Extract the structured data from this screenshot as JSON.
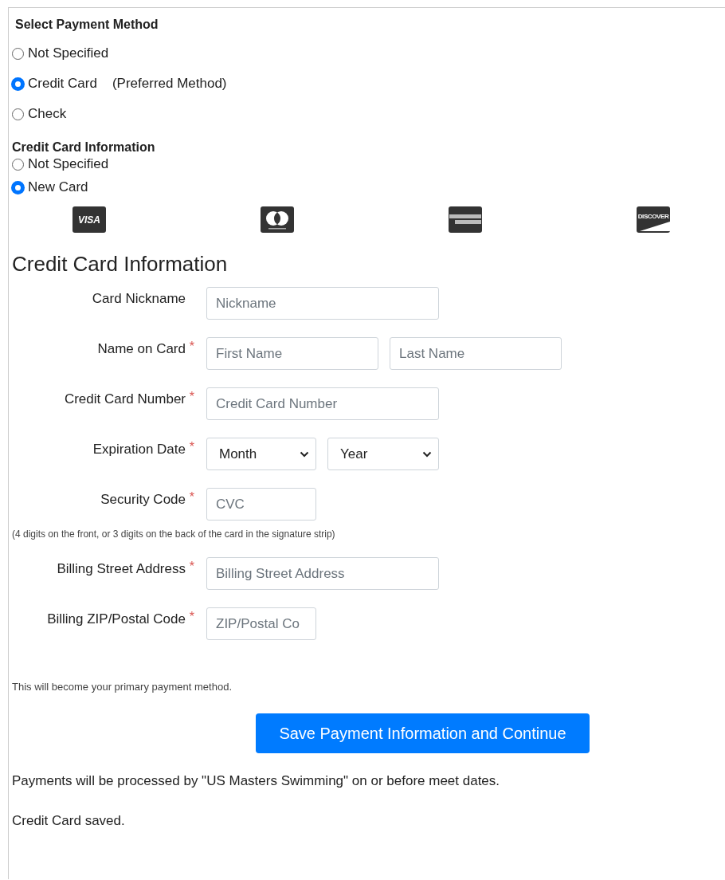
{
  "payment_method": {
    "title": "Select Payment Method",
    "options": [
      {
        "label": "Not Specified",
        "selected": false
      },
      {
        "label": "Credit Card",
        "note": "(Preferred Method)",
        "selected": true
      },
      {
        "label": "Check",
        "selected": false
      }
    ]
  },
  "card_choice": {
    "title": "Credit Card Information",
    "options": [
      {
        "label": "Not Specified",
        "selected": false
      },
      {
        "label": "New Card",
        "selected": true
      }
    ]
  },
  "card_logos": [
    {
      "kind": "visa",
      "label": "VISA"
    },
    {
      "kind": "mastercard"
    },
    {
      "kind": "amex"
    },
    {
      "kind": "discover",
      "label": "DISCOVER"
    }
  ],
  "form": {
    "title": "Credit Card Information",
    "rows": [
      {
        "label": "Card Nickname",
        "required": false,
        "fields": [
          {
            "kind": "text",
            "placeholder": "Nickname"
          }
        ]
      },
      {
        "label": "Name on Card",
        "required": true,
        "fields": [
          {
            "kind": "text",
            "placeholder": "First Name"
          },
          {
            "kind": "text",
            "placeholder": "Last Name"
          }
        ]
      },
      {
        "label": "Credit Card Number",
        "required": true,
        "fields": [
          {
            "kind": "text",
            "placeholder": "Credit Card Number"
          }
        ]
      },
      {
        "label": "Expiration Date",
        "required": true,
        "fields": [
          {
            "kind": "select",
            "value": "Month"
          },
          {
            "kind": "select",
            "value": "Year"
          }
        ]
      },
      {
        "label": "Security Code",
        "required": true,
        "fields": [
          {
            "kind": "text",
            "placeholder": "CVC"
          }
        ],
        "hint": "(4 digits on the front, or 3 digits on the back of the card in the signature strip)"
      },
      {
        "label": "Billing Street Address",
        "required": true,
        "fields": [
          {
            "kind": "text",
            "placeholder": "Billing Street Address"
          }
        ]
      },
      {
        "label": "Billing ZIP/Postal Code",
        "required": true,
        "fields": [
          {
            "kind": "text",
            "placeholder": "ZIP/Postal Co"
          }
        ]
      }
    ],
    "required_mark": "*"
  },
  "primary_note": "This will become your primary payment method.",
  "save_button": "Save Payment Information and Continue",
  "processing_note": "Payments will be processed by \"US Masters Swimming\" on or before meet dates.",
  "status": "Credit Card saved."
}
